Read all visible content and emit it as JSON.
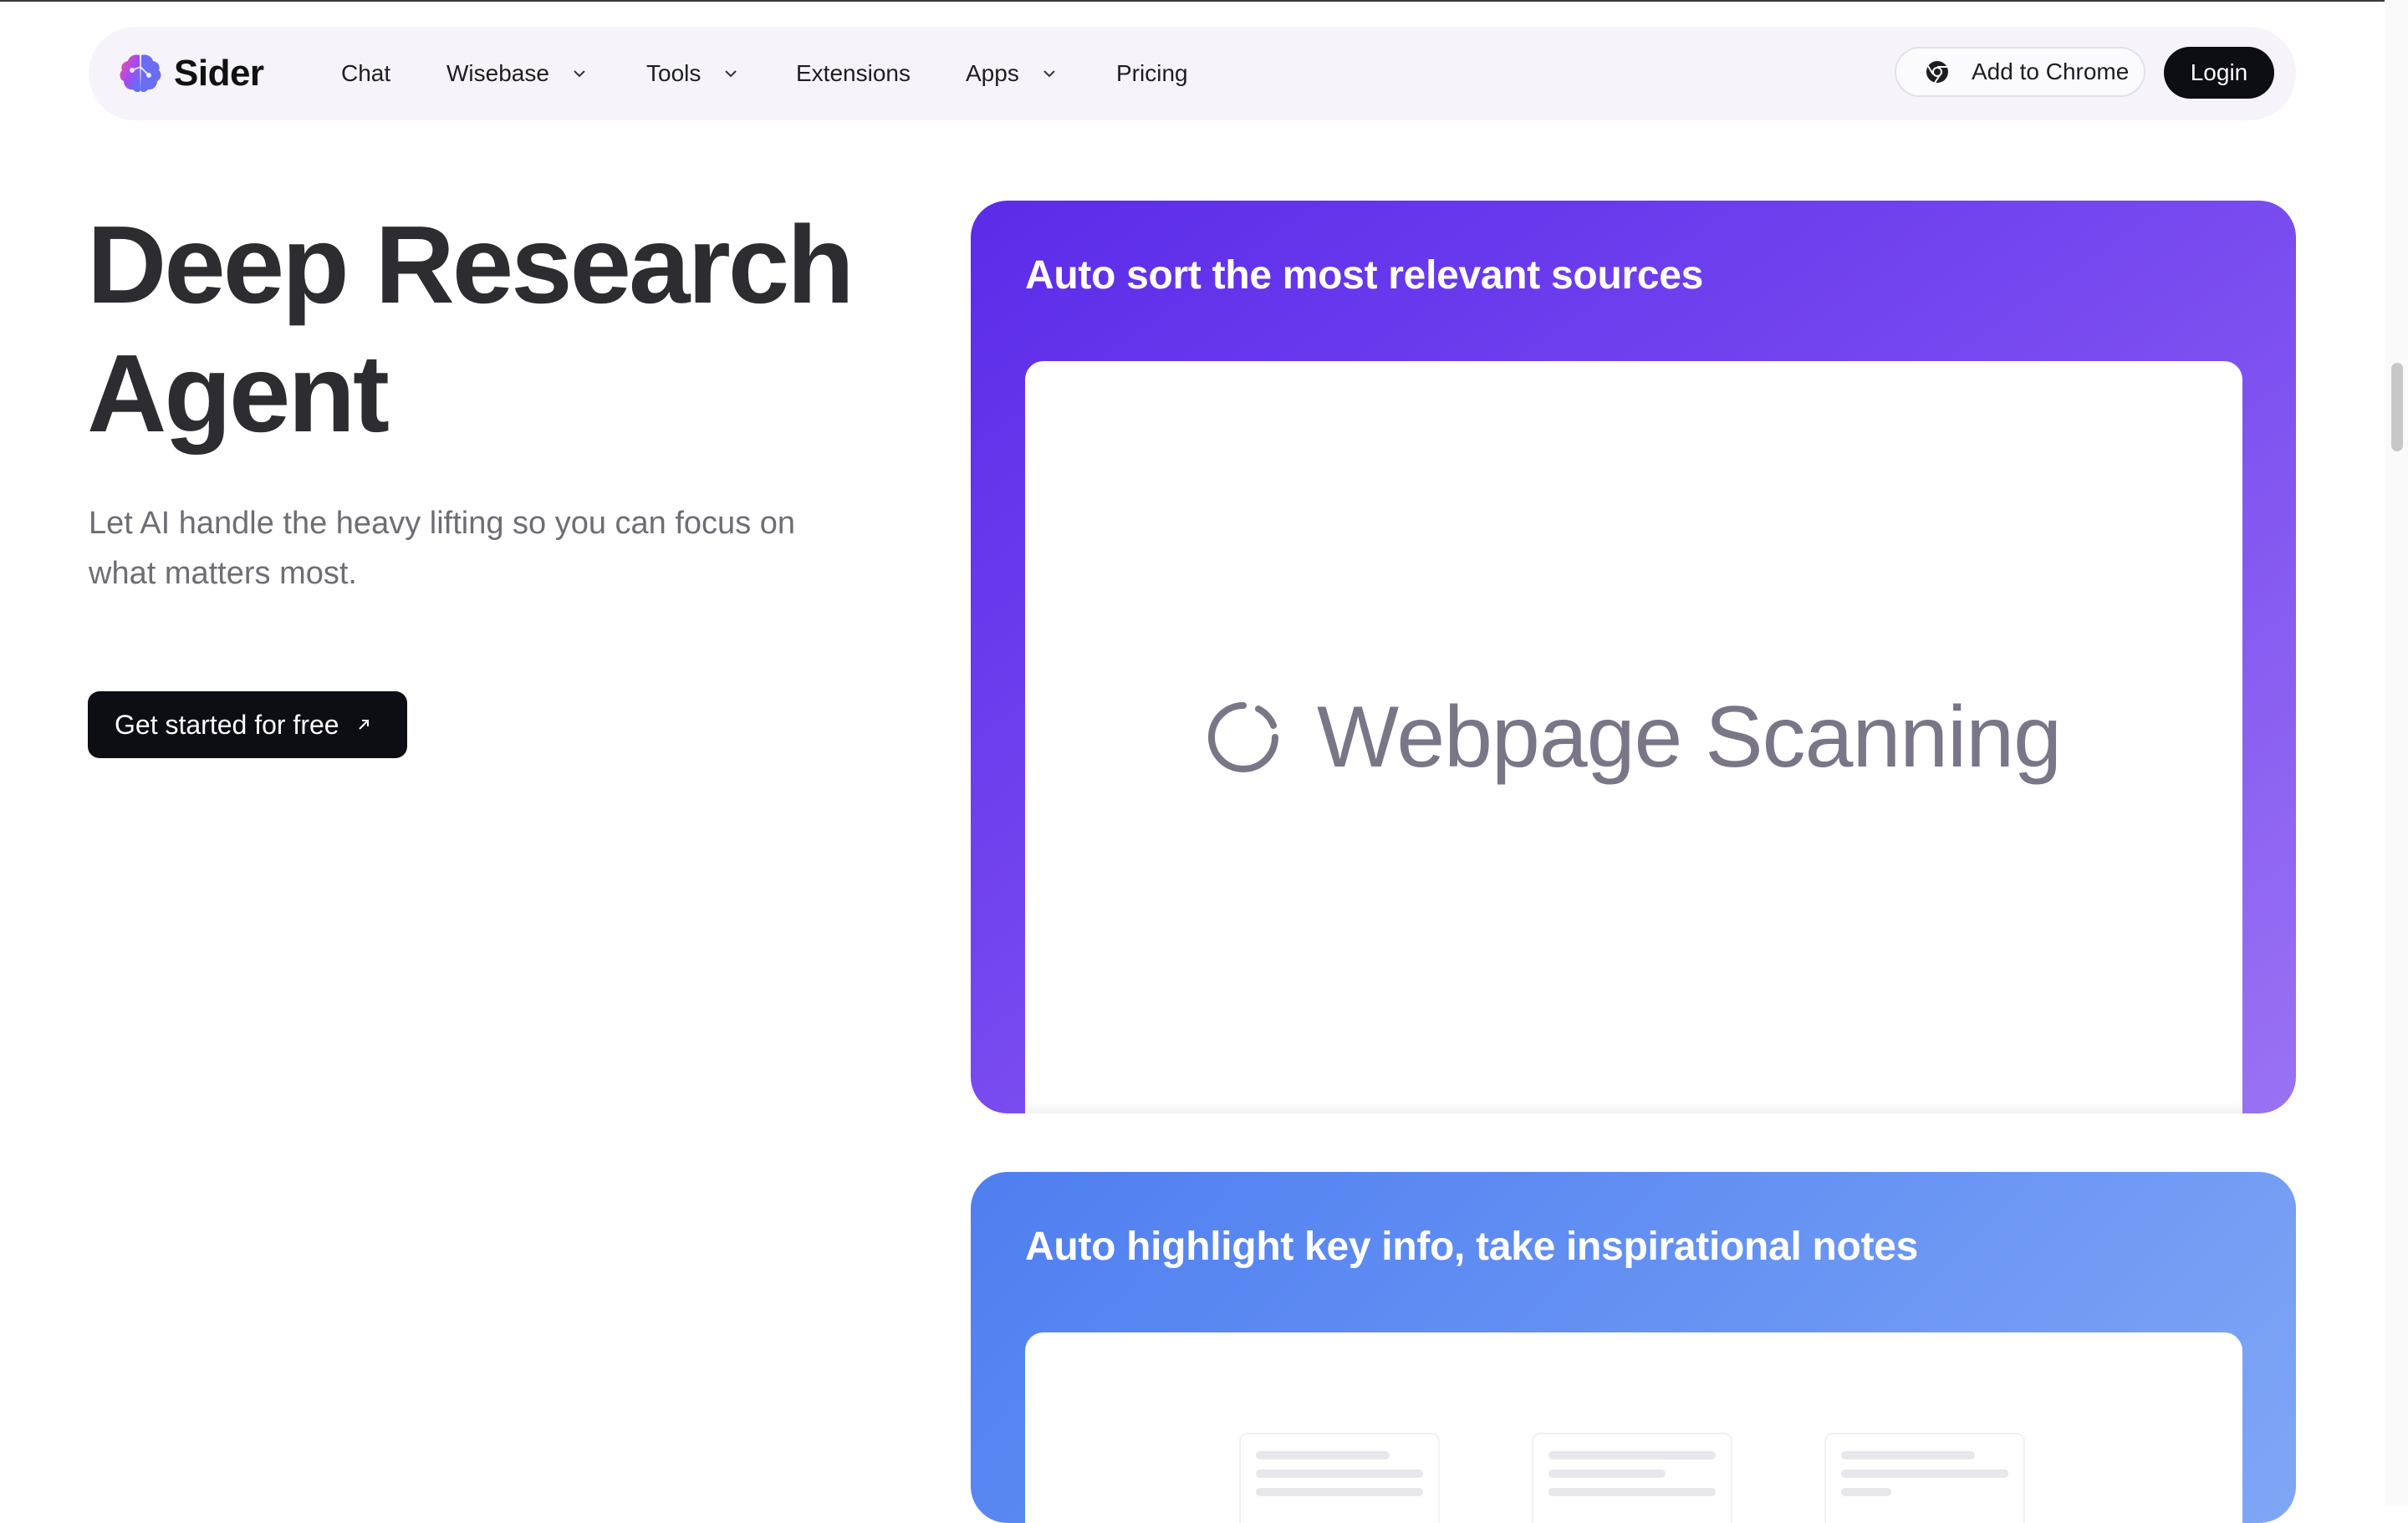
{
  "nav": {
    "logo_text": "Sider",
    "items": [
      {
        "label": "Chat",
        "has_dropdown": false
      },
      {
        "label": "Wisebase",
        "has_dropdown": true
      },
      {
        "label": "Tools",
        "has_dropdown": true
      },
      {
        "label": "Extensions",
        "has_dropdown": false
      },
      {
        "label": "Apps",
        "has_dropdown": true
      },
      {
        "label": "Pricing",
        "has_dropdown": false
      }
    ],
    "add_to_chrome": "Add to Chrome",
    "login": "Login"
  },
  "hero": {
    "title_line1": "Deep Research",
    "title_line2": "Agent",
    "subtitle": "Let AI handle the heavy lifting so you can focus on what matters most.",
    "cta": "Get started for free"
  },
  "cards": [
    {
      "title": "Auto sort the most relevant sources",
      "status_text": "Webpage Scanning"
    },
    {
      "title": "Auto highlight key info, take inspirational notes"
    }
  ],
  "colors": {
    "card1_gradient_start": "#5b2be9",
    "card1_gradient_end": "#9a72f3",
    "card2_gradient_start": "#4f7ef0",
    "card2_gradient_end": "#80a6f5",
    "button_dark": "#0d0d14"
  },
  "icons": {
    "logo": "brain-icon",
    "chrome": "chrome-icon",
    "cta_arrow": "arrow-up-right-icon",
    "loading": "spinner-icon"
  }
}
